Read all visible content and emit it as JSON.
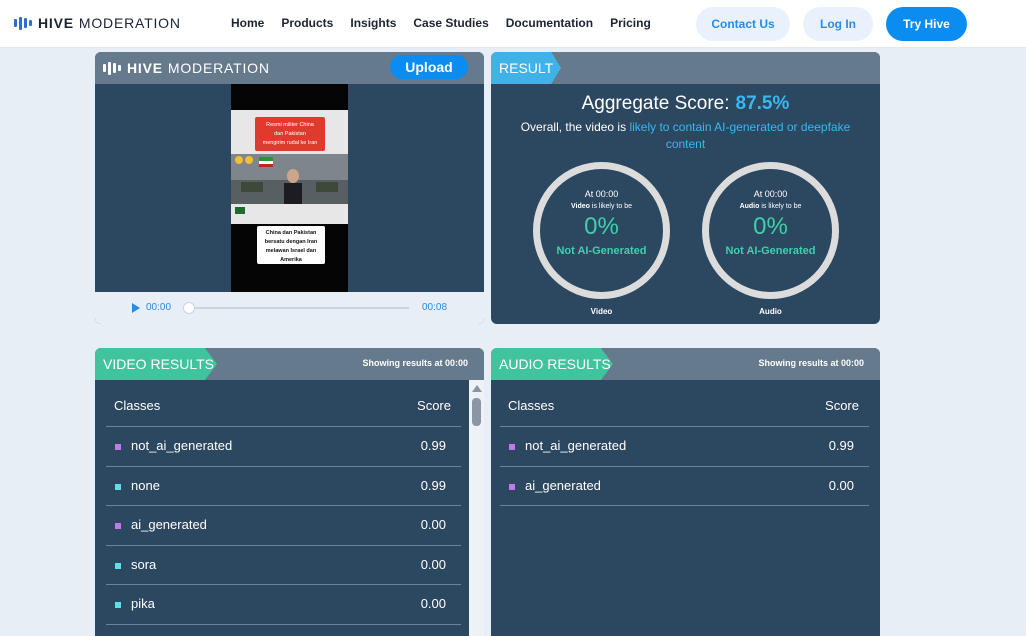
{
  "nav": {
    "brand_strong": "HIVE",
    "brand_light": "MODERATION",
    "links": [
      "Home",
      "Products",
      "Insights",
      "Case Studies",
      "Documentation",
      "Pricing"
    ],
    "contact_label": "Contact Us",
    "login_label": "Log In",
    "try_label": "Try Hive"
  },
  "upload_panel": {
    "brand_strong": "HIVE",
    "brand_light": "MODERATION",
    "upload_label": "Upload",
    "video": {
      "caption_top": "Resmi militer China dan Pakistan mengirim rudal ke Iran",
      "caption_bottom": "China dan Pakistan bersatu dengan Iran melawan Israel dan Amerika"
    },
    "player": {
      "current_time": "00:00",
      "duration": "00:08",
      "progress": 0
    }
  },
  "result": {
    "tag": "RESULT",
    "aggregate_label": "Aggregate Score:",
    "aggregate_value": "87.5%",
    "overall_prefix": "Overall, the video is",
    "overall_highlight": "likely to contain AI-generated or deepfake content",
    "gauges": [
      {
        "at": "At 00:00",
        "subject": "Video",
        "likely": "is likely to be",
        "percent": "0%",
        "verdict": "Not AI-Generated",
        "label": "Video"
      },
      {
        "at": "At 00:00",
        "subject": "Audio",
        "likely": "is likely to be",
        "percent": "0%",
        "verdict": "Not AI-Generated",
        "label": "Audio"
      }
    ]
  },
  "video_results": {
    "tag": "VIDEO RESULTS",
    "showing": "Showing results at 00:00",
    "col_class": "Classes",
    "col_score": "Score",
    "rows": [
      {
        "name": "not_ai_generated",
        "score": "0.99",
        "color": "#c07ae8"
      },
      {
        "name": "none",
        "score": "0.99",
        "color": "#5fe0e8"
      },
      {
        "name": "ai_generated",
        "score": "0.00",
        "color": "#c07ae8"
      },
      {
        "name": "sora",
        "score": "0.00",
        "color": "#5fe0e8"
      },
      {
        "name": "pika",
        "score": "0.00",
        "color": "#5fe0e8"
      }
    ]
  },
  "audio_results": {
    "tag": "AUDIO RESULTS",
    "showing": "Showing results at 00:00",
    "col_class": "Classes",
    "col_score": "Score",
    "rows": [
      {
        "name": "not_ai_generated",
        "score": "0.99",
        "color": "#c07ae8"
      },
      {
        "name": "ai_generated",
        "score": "0.00",
        "color": "#c07ae8"
      }
    ]
  }
}
